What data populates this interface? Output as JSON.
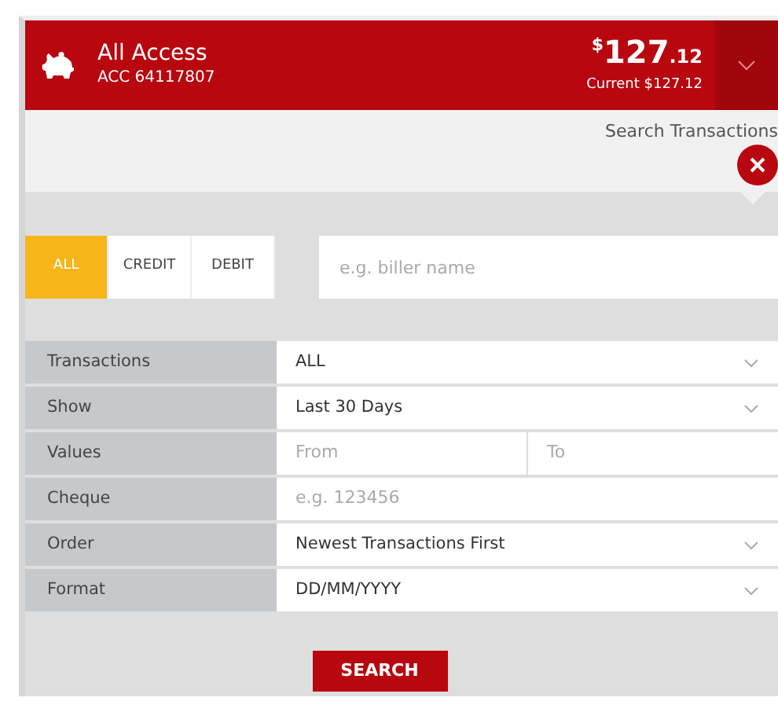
{
  "account": {
    "name": "All Access",
    "number": "ACC 64117807",
    "balance": {
      "currency": "$",
      "whole": "127",
      "cents": ".12"
    },
    "current": "Current $127.12"
  },
  "search_title": "Search Transactions",
  "type_filter": [
    {
      "label": "ALL",
      "selected": true
    },
    {
      "label": "CREDIT",
      "selected": false
    },
    {
      "label": "DEBIT",
      "selected": false
    }
  ],
  "search": {
    "placeholder": "e.g. biller name"
  },
  "criteria": [
    {
      "kind": "select",
      "label": "Transactions",
      "value": "ALL"
    },
    {
      "kind": "select",
      "label": "Show",
      "value": "Last 30 Days"
    },
    {
      "kind": "range",
      "label": "Values",
      "placeholders": [
        "From",
        "To"
      ]
    },
    {
      "kind": "text",
      "label": "Cheque",
      "placeholder": "e.g. 123456"
    },
    {
      "kind": "select",
      "label": "Order",
      "value": "Newest Transactions First"
    },
    {
      "kind": "select",
      "label": "Format",
      "value": "DD/MM/YYYY"
    }
  ],
  "button": "SEARCH"
}
